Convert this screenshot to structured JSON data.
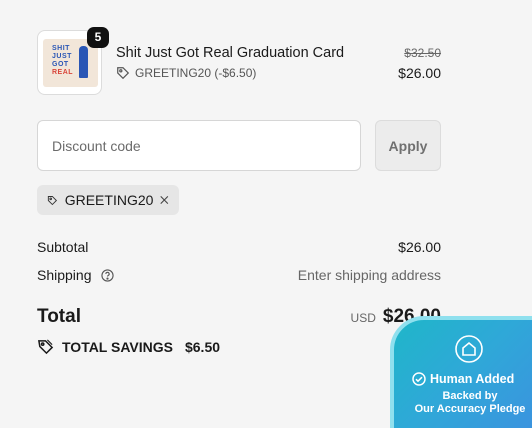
{
  "product": {
    "title": "Shit Just Got Real Graduation Card",
    "quantity": "5",
    "discount_label": "GREETING20 (-$6.50)",
    "price_original": "$32.50",
    "price_discounted": "$26.00",
    "card_art": {
      "line1": "SHIT",
      "line2": "JUST",
      "line3": "GOT",
      "line4": "REAL"
    }
  },
  "discount_form": {
    "placeholder": "Discount code",
    "apply_label": "Apply"
  },
  "applied_code": {
    "code": "GREETING20"
  },
  "summary": {
    "subtotal_label": "Subtotal",
    "subtotal_value": "$26.00",
    "shipping_label": "Shipping",
    "shipping_value": "Enter shipping address",
    "total_label": "Total",
    "total_currency": "USD",
    "total_value": "$26.00",
    "savings_label": "TOTAL SAVINGS",
    "savings_value": "$6.50"
  },
  "trust_badge": {
    "title": "Human Added",
    "line1": "Backed by",
    "line2": "Our Accuracy Pledge"
  },
  "colors": {
    "accent_badge": "#2fa8d8",
    "badge_bg": "#111111"
  }
}
